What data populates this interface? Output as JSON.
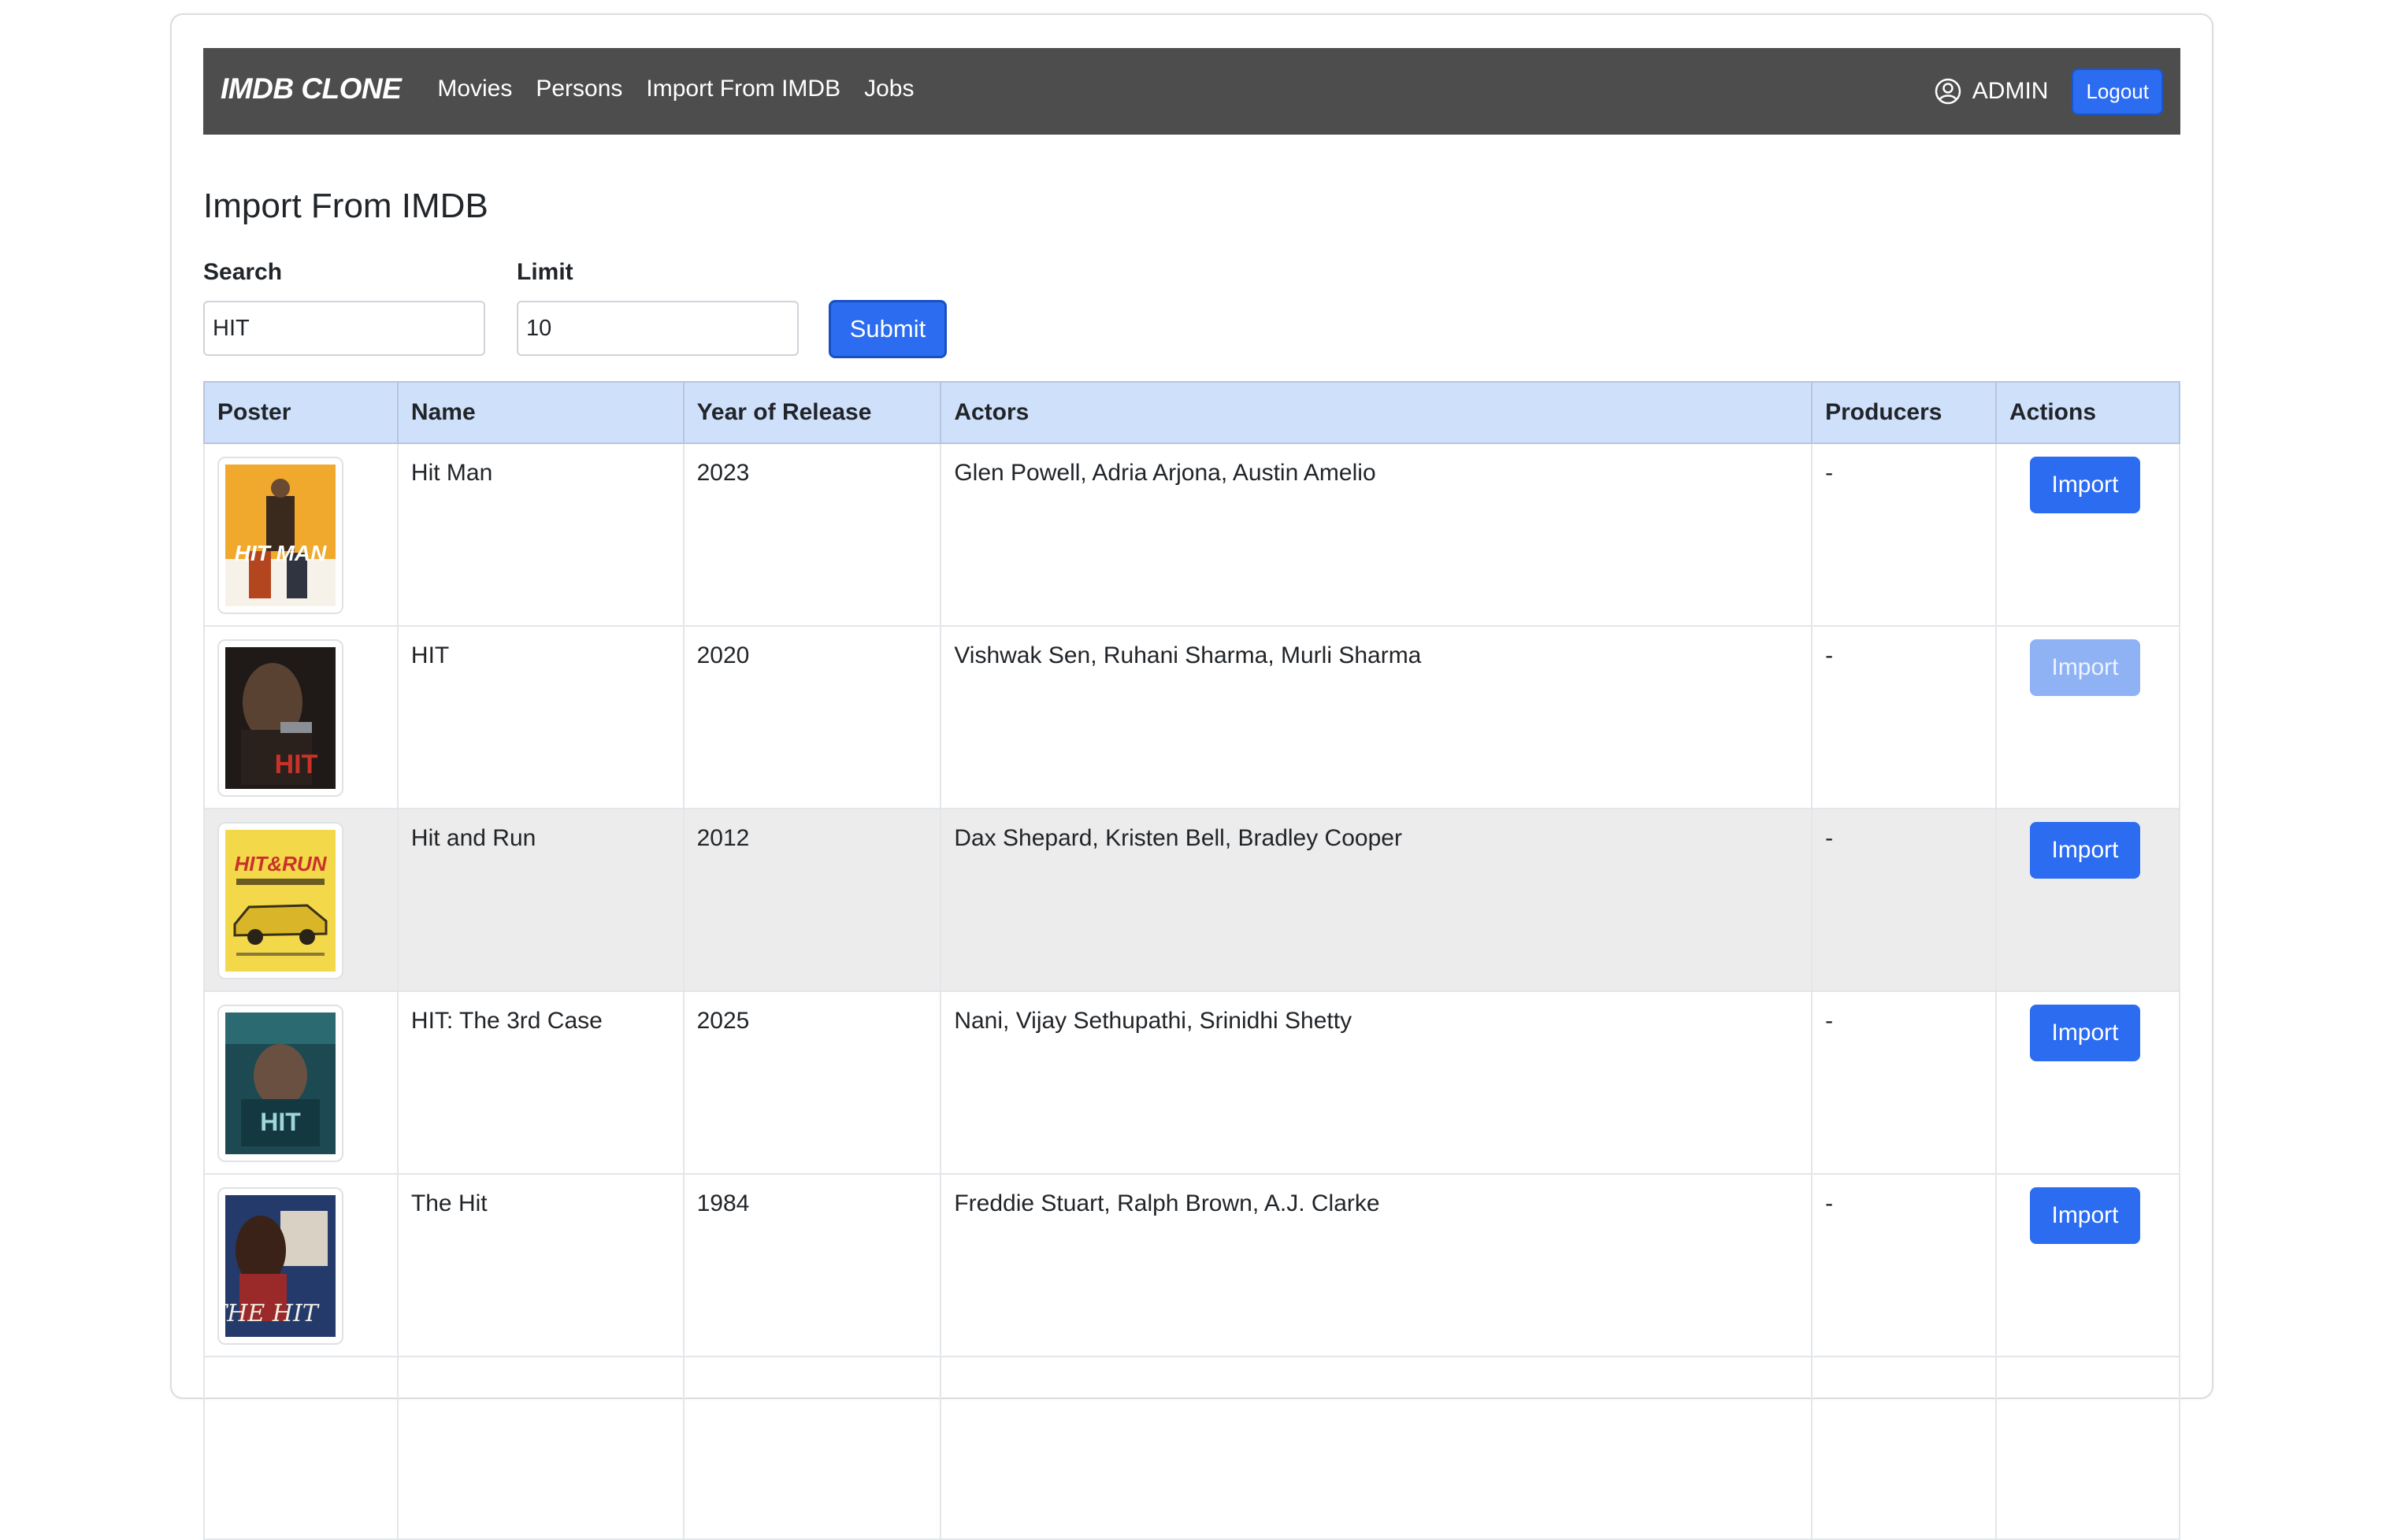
{
  "navbar": {
    "brand": "IMDB CLONE",
    "links": [
      "Movies",
      "Persons",
      "Import From IMDB",
      "Jobs"
    ],
    "user": "ADMIN",
    "logout": "Logout"
  },
  "page": {
    "title": "Import From IMDB"
  },
  "form": {
    "search_label": "Search",
    "search_value": "HIT",
    "limit_label": "Limit",
    "limit_value": "10",
    "submit": "Submit"
  },
  "table": {
    "headers": [
      "Poster",
      "Name",
      "Year of Release",
      "Actors",
      "Producers",
      "Actions"
    ],
    "rows": [
      {
        "name": "Hit Man",
        "year": "2023",
        "actors": "Glen Powell, Adria Arjona, Austin Amelio",
        "producers": "-",
        "action": "Import",
        "action_disabled": false
      },
      {
        "name": "HIT",
        "year": "2020",
        "actors": "Vishwak Sen, Ruhani Sharma, Murli Sharma",
        "producers": "-",
        "action": "Import",
        "action_disabled": true
      },
      {
        "name": "Hit and Run",
        "year": "2012",
        "actors": "Dax Shepard, Kristen Bell, Bradley Cooper",
        "producers": "-",
        "action": "Import",
        "action_disabled": false
      },
      {
        "name": "HIT: The 3rd Case",
        "year": "2025",
        "actors": "Nani, Vijay Sethupathi, Srinidhi Shetty",
        "producers": "-",
        "action": "Import",
        "action_disabled": false
      },
      {
        "name": "The Hit",
        "year": "1984",
        "actors": "Freddie Stuart, Ralph Brown, A.J. Clarke",
        "producers": "-",
        "action": "Import",
        "action_disabled": false
      }
    ]
  },
  "colors": {
    "navbar_bg": "#4d4d4d",
    "primary": "#2c6cf0",
    "primary_disabled": "#8fb2f5",
    "table_header_bg": "#cfe0fb",
    "row_hover_bg": "#ececec"
  },
  "icons": {
    "user": "user-circle-icon"
  }
}
